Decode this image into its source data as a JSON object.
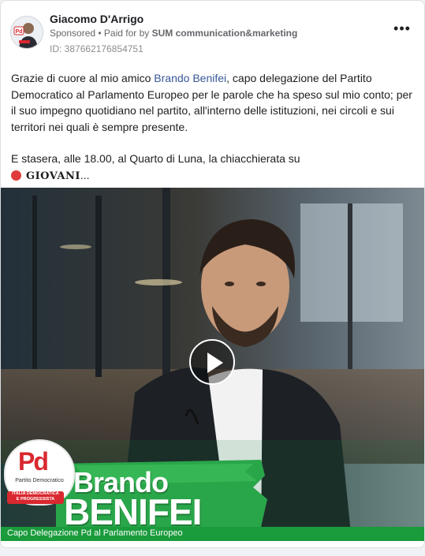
{
  "post": {
    "author": "Giacomo D'Arrigo",
    "sponsored": "Sponsored",
    "paid_for_prefix": " • Paid for by ",
    "paid_for_by": "SUM communication&marketing",
    "ad_id": "ID: 387662176854751",
    "more_icon": "more-options-icon",
    "avatar_badge": "Pd"
  },
  "body": {
    "p1_part1": "Grazie di cuore al mio amico ",
    "p1_link": "Brando Benifei",
    "p1_part2": ", capo delegazione del Partito Democratico al Parlamento Europeo per le parole che ha speso sul mio conto; per il suo impegno quotidiano nel partito, all'interno delle istituzioni, nei circoli e sui territori nei quali è sempre presente.",
    "p2": "E stasera, alle 18.00, al Quarto di Luna, la chiacchierata su",
    "p3_label": "GIOVANI",
    "p3_more": "..."
  },
  "video": {
    "logo_main": "Pd",
    "logo_line": "Partito Democratico",
    "logo_band1": "ITALIA DEMOCRATICA",
    "logo_band2": "E PROGRESSISTA",
    "first_name": "Brando",
    "last_name": "BENIFEI",
    "caption": "Capo Delegazione Pd al Parlamento Europeo",
    "play_icon": "play-icon"
  },
  "colors": {
    "link": "#385898",
    "pd_red": "#d9282f",
    "pd_green": "#1a9b3c"
  }
}
